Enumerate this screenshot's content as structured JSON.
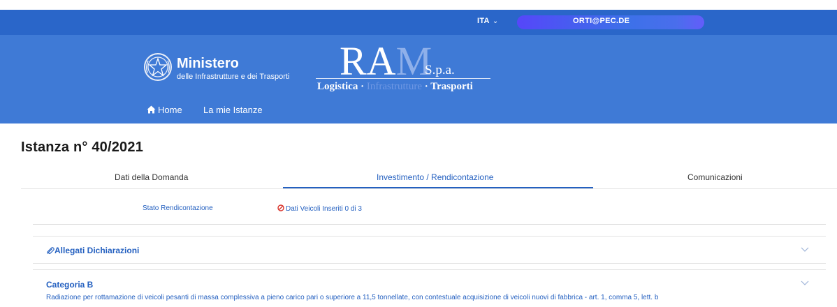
{
  "topbar": {
    "language": "ITA",
    "user_email": "ORTI@PEC.DE"
  },
  "header": {
    "ministry_title": "Ministero",
    "ministry_subtitle": "delle Infrastrutture e dei Trasporti",
    "ram": {
      "letters_main": "RA",
      "letters_m": "M",
      "suffix": "S.p.a.",
      "tag_left": "Logistica ·",
      "tag_mid": " Infrastrutture ",
      "tag_right": "· Trasporti"
    },
    "nav": {
      "home": "Home",
      "istanze": "La mie Istanze"
    }
  },
  "page": {
    "title": "Istanza n° 40/2021"
  },
  "tabs": [
    {
      "label": "Dati della Domanda",
      "active": false
    },
    {
      "label": "Investimento / Rendicontazione",
      "active": true
    },
    {
      "label": "Comunicazioni",
      "active": false
    }
  ],
  "status": {
    "label": "Stato Rendicontazione",
    "value": "Dati Veicoli Inseriti 0 di 3",
    "icon": "ban-icon"
  },
  "panels": {
    "allegati": {
      "title": "Allegati Dichiarazioni",
      "icon": "paperclip-icon"
    },
    "categoria": {
      "title": "Categoria B",
      "description": "Radiazione per rottamazione di veicoli pesanti di massa complessiva a pieno carico pari o superiore a 11,5 tonnellate, con contestuale acquisizione di veicoli nuovi di fabbrica - art. 1, comma 5, lett. b"
    }
  },
  "colors": {
    "topbar": "#2a66c9",
    "header": "#3f7ad6",
    "accent": "#2460c0",
    "error": "#d9342b"
  }
}
